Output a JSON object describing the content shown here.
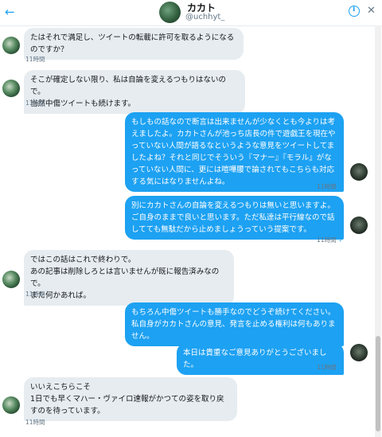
{
  "header": {
    "name": "カカト",
    "handle": "@uchhyt_"
  },
  "messages": [
    {
      "dir": "in",
      "text": "たはそれで満足し、ツイートの転載に許可を取るようになるのですか？",
      "time": "11時間"
    },
    {
      "dir": "in",
      "text": "そこが確定しない限り、私は自論を変えるつもりはないので。\n当然中傷ツイートも続けます。",
      "time": "11時間"
    },
    {
      "dir": "out",
      "text": "もしもの話なので断言は出来ませんが少なくとも今よりは考えましたよ。カカトさんが池っち店長の件で遊戯王を現在やっていない人間が語るなというような意見をツイートしてましたよね？それと同じでそういう『マナー』『モラル』がなっていない人間に、更には喧嘩腰で論されてもこちらも対応する気にはなりませんよね。",
      "time": "11時間"
    },
    {
      "dir": "out",
      "text": "別にカカトさんの自論を変えるつもりは無いと思いますよ。ご自身のままで良いと思います。ただ私達は平行線なので話してても無駄だから止めましょうっていう提案です。",
      "time": "11時間"
    },
    {
      "dir": "in",
      "text": "ではこの話はこれで終わりで。\nあの記事は削除しろとは言いませんが既に報告済みなので。\nまた何かあれば。",
      "time": "11時間"
    },
    {
      "dir": "out",
      "text": "もちろん中傷ツイートも勝手なのでどうぞ続けてください。私自身がカカトさんの意見、発言を止める権利は何もありません。",
      "time": ""
    },
    {
      "dir": "out",
      "text": "本日は貴重なご意見ありがとうございました。",
      "time": "11時間"
    },
    {
      "dir": "in",
      "text": "いいえこちらこそ\n1日でも早くマハー・ヴァイロ速報がかつての姿を取り戻すのを待っています。",
      "time": "11時間"
    }
  ],
  "icons": {
    "back": "arrow-left-icon",
    "info": "info-icon",
    "close": "close-icon"
  },
  "colors": {
    "accent": "#1da1f2",
    "incoming": "#e6ecf0"
  }
}
